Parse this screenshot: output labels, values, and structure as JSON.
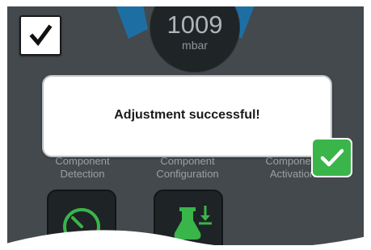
{
  "gauge": {
    "value": "1009",
    "unit": "mbar"
  },
  "confirm_icon": "checkmark-icon",
  "tiles": [
    {
      "label": "Component Detection",
      "icon": "speedometer-icon"
    },
    {
      "label": "Component Configuration",
      "icon": "flask-icon"
    },
    {
      "label": "Component Activation",
      "icon": ""
    }
  ],
  "dialog": {
    "message": "Adjustment successful!",
    "ok_icon": "checkmark-icon"
  },
  "colors": {
    "screen_bg": "#43494d",
    "accent_blue": "#1d6fa3",
    "icon_green": "#39b54a",
    "ok_button": "#3ab54a"
  }
}
